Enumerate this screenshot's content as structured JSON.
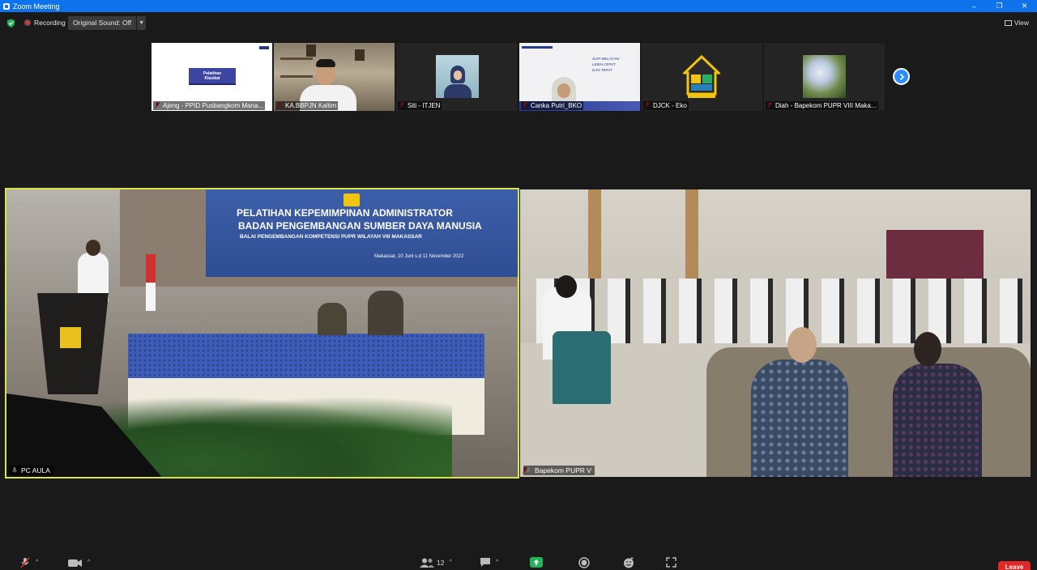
{
  "window": {
    "title": "Zoom Meeting",
    "controls": [
      "–",
      "❐",
      "✕"
    ]
  },
  "topbar": {
    "recording_label": "Recording",
    "sound_label": "Original Sound: Off",
    "view_label": "View"
  },
  "thumbnails": [
    {
      "name": "Ajeng - PPID Pusbangkom Mana...",
      "slide_title": "Pelatihan\nKlasikal"
    },
    {
      "name": "KA.BBPJN Kaltim"
    },
    {
      "name": "Siti - ITJEN"
    },
    {
      "name": "Canka Putri_BKO",
      "slide_text": "SIAP MELAYANI\nLEBIH CEPAT\nDAN TEPAT"
    },
    {
      "name": "DJCK - Eko"
    },
    {
      "name": "Diah - Bapekom PUPR VIII Maka..."
    }
  ],
  "videos": {
    "left": {
      "name": "PC AULA",
      "banner_line1": "PELATIHAN KEPEMIMPINAN ADMINISTRATOR",
      "banner_line2": "BADAN PENGEMBANGAN SUMBER DAYA MANUSIA",
      "banner_line3": "BALAI PENGEMBANGAN KOMPETENSI PUPR WILAYAH VIII MAKASSAR",
      "banner_date": "Makassar, 10 Juni s.d 11 November 2022"
    },
    "right": {
      "name": "Bapekom PUPR V"
    }
  },
  "toolbar": {
    "participants_count": "12",
    "leave_label": "Leave"
  },
  "colors": {
    "accent": "#2d8cff",
    "active_speaker": "#d9e34a",
    "leave": "#e02828"
  }
}
